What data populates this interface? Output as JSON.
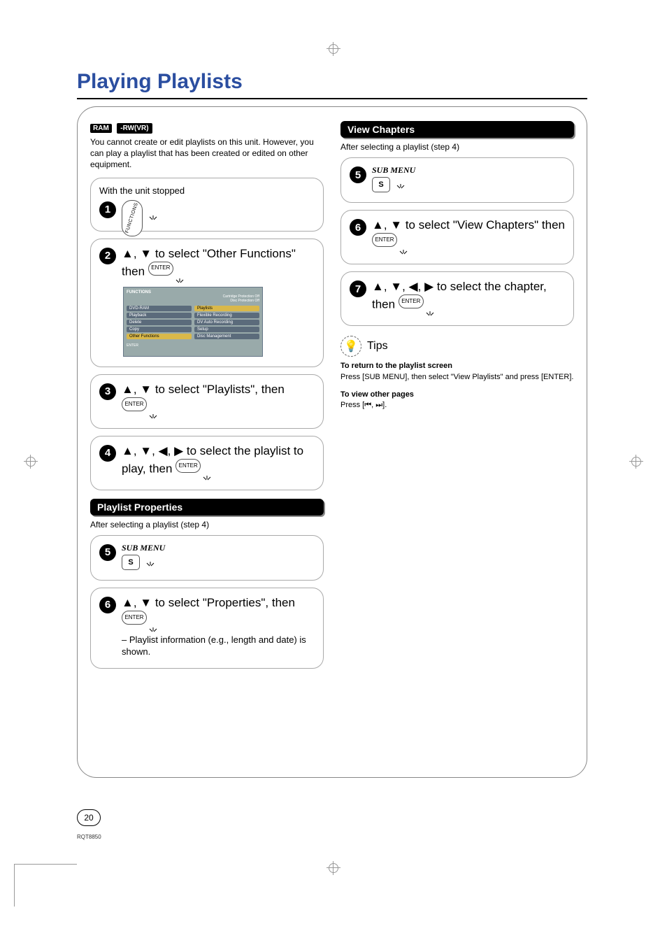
{
  "title": "Playing Playlists",
  "badges": {
    "ram": "RAM",
    "rw": "-RW(VR)"
  },
  "intro": "You cannot create or edit playlists on this unit. However, you can play a playlist that has been created or edited on other equipment.",
  "steps": {
    "s1_pretext": "With the unit stopped",
    "s1_btn": "FUNCTIONS",
    "s2": "▲, ▼ to select \"Other Functions\" then",
    "s2_enter": "ENTER",
    "s3": "▲, ▼ to select \"Playlists\", then",
    "s3_enter": "ENTER",
    "s4": "▲, ▼, ◀, ▶ to select the playlist to play, then",
    "s4_enter": "ENTER"
  },
  "osd": {
    "title": "FUNCTIONS",
    "sub1": "Cartridge Protection  Off",
    "sub2": "Disc Protection  Off",
    "media": "DVD-RAM",
    "left": [
      "Playback",
      "Delete",
      "Copy",
      "Other Functions"
    ],
    "right": [
      "Playlists",
      "Flexible Recording",
      "DV Auto Recording",
      "Setup",
      "Disc Management"
    ],
    "footer": "ENTER"
  },
  "playlist_props": {
    "header": "Playlist Properties",
    "after": "After selecting a playlist (step 4)",
    "s5_label": "SUB MENU",
    "s5_btn": "S",
    "s6": "▲, ▼ to select \"Properties\", then",
    "s6_enter": "ENTER",
    "s6_note": "– Playlist information (e.g., length and date) is shown."
  },
  "view_chapters": {
    "header": "View Chapters",
    "after": "After selecting a playlist (step 4)",
    "s5_label": "SUB MENU",
    "s5_btn": "S",
    "s6": "▲, ▼ to select \"View Chapters\" then",
    "s6_enter": "ENTER",
    "s7": "▲, ▼, ◀, ▶ to select the chapter, then",
    "s7_enter": "ENTER"
  },
  "tips": {
    "title": "Tips",
    "h1": "To return to the playlist screen",
    "t1": "Press [SUB MENU], then select \"View Playlists\" and press [ENTER].",
    "h2": "To view other pages",
    "t2": "Press [⏮, ⏭]."
  },
  "page_number": "20",
  "doc_code": "RQT8850"
}
